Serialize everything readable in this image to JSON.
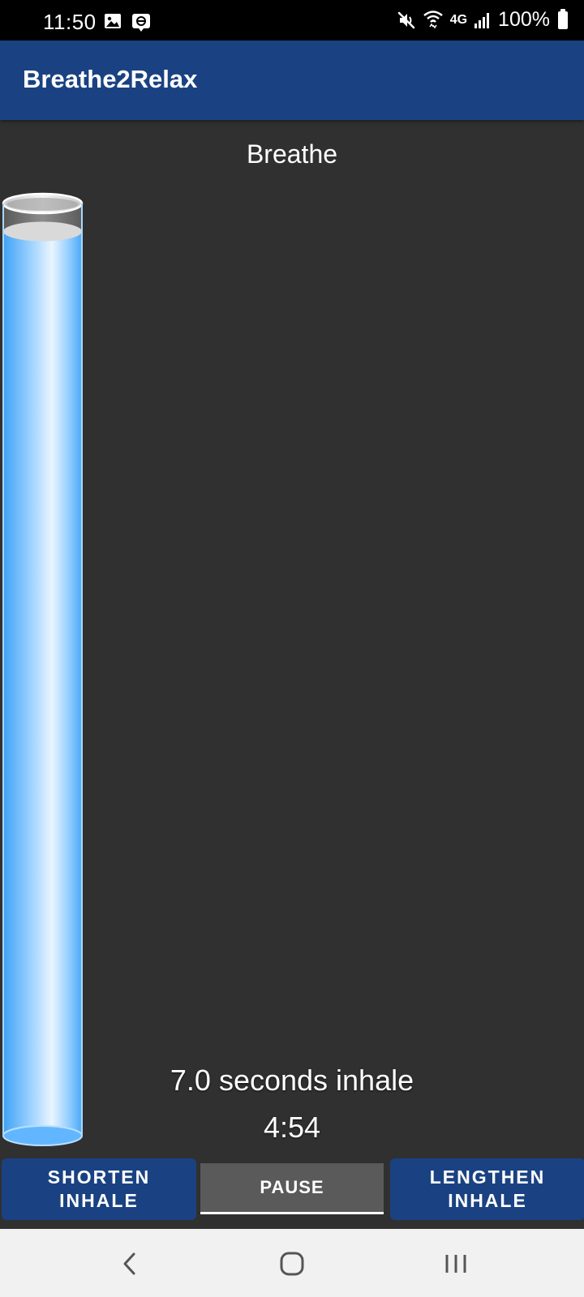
{
  "status_bar": {
    "time": "11:50",
    "battery": "100%",
    "network": "4G",
    "icons": [
      "gallery-icon",
      "app-notification-icon",
      "mute-icon",
      "wifi-icon",
      "signal-icon",
      "battery-icon"
    ]
  },
  "app_bar": {
    "title": "Breathe2Relax"
  },
  "main": {
    "phase_label": "Breathe",
    "breath_status": "7.0 seconds inhale",
    "timer": "4:54",
    "fill_level_percent": 97
  },
  "controls": {
    "shorten_line1": "SHORTEN",
    "shorten_line2": "INHALE",
    "pause_label": "PAUSE",
    "lengthen_line1": "LENGTHEN",
    "lengthen_line2": "INHALE"
  },
  "nav": {
    "icons": [
      "back-icon",
      "home-icon",
      "recents-icon"
    ]
  },
  "colors": {
    "accent": "#1a4282",
    "background": "#303030",
    "water": "#5eb8ff"
  }
}
